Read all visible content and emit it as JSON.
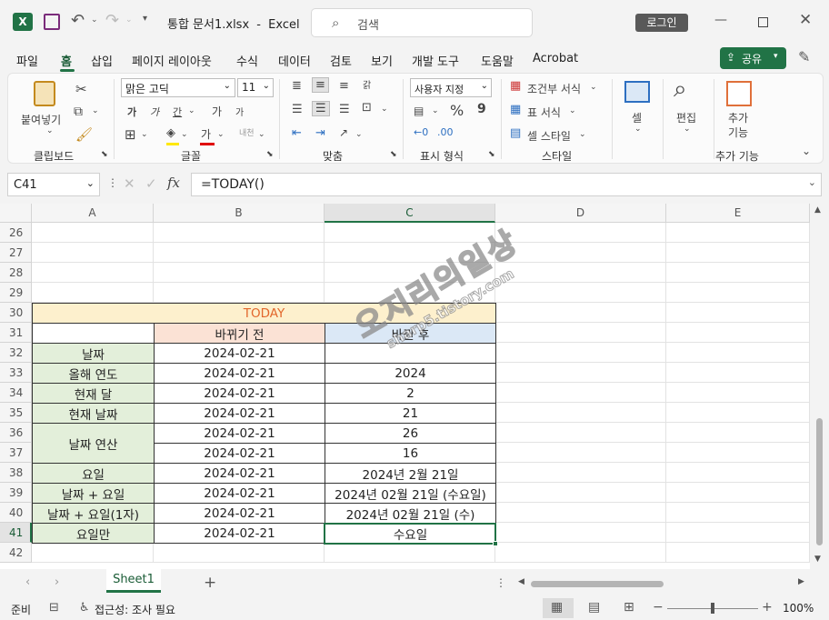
{
  "titlebar": {
    "autosave_icon": "excel-app-icon",
    "file_name": "통합 문서1.xlsx",
    "dash": "-",
    "app_name": "Excel",
    "search_placeholder": "검색",
    "login_label": "로그인"
  },
  "menu": {
    "tabs": [
      "파일",
      "홈",
      "삽입",
      "페이지 레이아웃",
      "수식",
      "데이터",
      "검토",
      "보기",
      "개발 도구",
      "도움말",
      "Acrobat"
    ],
    "active": "홈",
    "share_label": "공유"
  },
  "ribbon": {
    "clipboard": {
      "paste_label": "붙여넣기",
      "group_label": "클립보드"
    },
    "font": {
      "font_name": "맑은 고딕",
      "font_size": "11",
      "group_label": "글꼴",
      "bold": "가",
      "italic": "가",
      "underline": "간",
      "grow": "가",
      "shrink": "가",
      "fill_letter": "가",
      "phonetic": "내천"
    },
    "alignment": {
      "group_label": "맞춤",
      "wrap": "갉"
    },
    "number": {
      "format": "사용자 지정",
      "group_label": "표시 형식",
      "percent": "%",
      "comma": "9"
    },
    "styles": {
      "conditional": "조건부 서식",
      "table": "표 서식",
      "cell_style": "셀 스타일",
      "group_label": "스타일"
    },
    "cells": {
      "label": "셀"
    },
    "editing": {
      "label": "편집"
    },
    "addins": {
      "label1": "추가",
      "label2": "기능",
      "group_label": "추가 기능"
    }
  },
  "formula_bar": {
    "name_box": "C41",
    "fx": "fx",
    "formula": "=TODAY()"
  },
  "grid": {
    "columns": [
      "A",
      "B",
      "C",
      "D",
      "E"
    ],
    "rows": [
      "26",
      "27",
      "28",
      "29",
      "30",
      "31",
      "32",
      "33",
      "34",
      "35",
      "36",
      "37",
      "38",
      "39",
      "40",
      "41",
      "42"
    ],
    "selected_cell": "C41",
    "title": "TODAY",
    "header_before": "바뀌기 전",
    "header_after": "바뀐 후",
    "table": [
      {
        "label": "날짜",
        "before": "2024-02-21",
        "after": ""
      },
      {
        "label": "올해 연도",
        "before": "2024-02-21",
        "after": "2024"
      },
      {
        "label": "현재 달",
        "before": "2024-02-21",
        "after": "2"
      },
      {
        "label": "현재 날짜",
        "before": "2024-02-21",
        "after": "21"
      },
      {
        "label": "날짜 연산",
        "before": "2024-02-21",
        "after": "26"
      },
      {
        "label": "",
        "before": "2024-02-21",
        "after": "16"
      },
      {
        "label": "요일",
        "before": "2024-02-21",
        "after": "2024년 2월 21일"
      },
      {
        "label": "날짜 + 요일",
        "before": "2024-02-21",
        "after": "2024년 02월 21일 (수요일)"
      },
      {
        "label": "날짜 + 요일(1자)",
        "before": "2024-02-21",
        "after": "2024년 02월 21일 (수)"
      },
      {
        "label": "요일만",
        "before": "2024-02-21",
        "after": "수요일"
      }
    ],
    "watermark_line1": "오지리의일상",
    "watermark_line2": "sharp5.tistory.com"
  },
  "sheets": {
    "tabs": [
      "Sheet1"
    ],
    "add_label": "+"
  },
  "status": {
    "ready": "준비",
    "accessibility": "접근성: 조사 필요",
    "zoom": "100%"
  },
  "colors": {
    "excel_green": "#217346",
    "title_fill": "#fdf0cd",
    "title_text": "#e2672c",
    "before_fill": "#fbe2d5",
    "after_fill": "#dbe8f6",
    "label_fill": "#e3efda"
  }
}
